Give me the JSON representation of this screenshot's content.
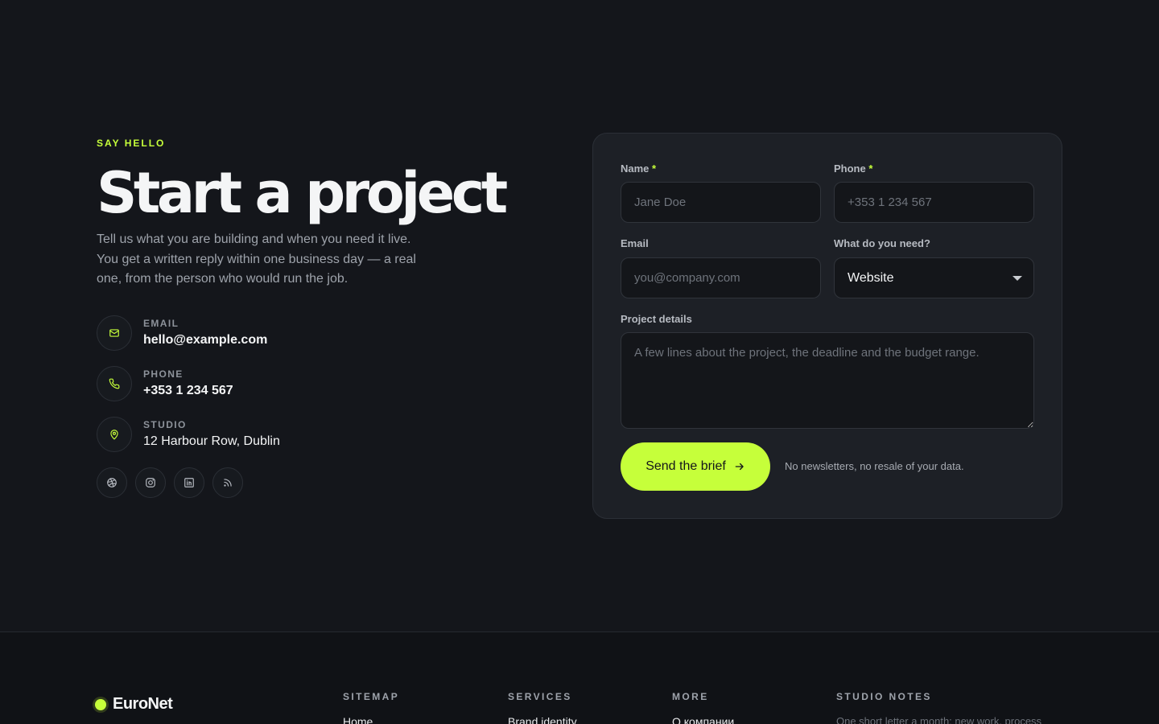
{
  "contact": {
    "eyebrow": "SAY HELLO",
    "title": "Start a project",
    "lede": "Tell us what you are building and when you need it live. You get a written reply within one business day — a real one, from the person who would run the job.",
    "email": {
      "label": "EMAIL",
      "value": "hello@example.com",
      "icon": "mail-icon"
    },
    "phone": {
      "label": "PHONE",
      "value": "+353 1 234 567",
      "icon": "phone-icon"
    },
    "studio": {
      "label": "STUDIO",
      "value": "12 Harbour Row, Dublin",
      "icon": "map-pin-icon"
    },
    "socials": [
      "dribbble-icon",
      "instagram-icon",
      "linkedin-icon",
      "rss-icon"
    ]
  },
  "form": {
    "name": {
      "label": "Name",
      "required_mark": "*",
      "placeholder": "Jane Doe"
    },
    "phone": {
      "label": "Phone",
      "required_mark": "*",
      "placeholder": "+353 1 234 567"
    },
    "email": {
      "label": "Email",
      "placeholder": "you@company.com"
    },
    "need": {
      "label": "What do you need?",
      "selected": "Website"
    },
    "details": {
      "label": "Project details",
      "placeholder": "A few lines about the project, the deadline and the budget range."
    },
    "submit_label": "Send the brief",
    "note": "No newsletters, no resale of your data."
  },
  "footer": {
    "brand": "EuroNet",
    "columns": [
      {
        "heading": "SITEMAP",
        "first_item": "Home"
      },
      {
        "heading": "SERVICES",
        "first_item": "Brand identity"
      },
      {
        "heading": "MORE",
        "first_item": "О компании"
      },
      {
        "heading": "STUDIO NOTES",
        "text": "One short letter a month: new work, process"
      }
    ]
  },
  "colors": {
    "background": "#14161b",
    "card": "#1d2026",
    "accent": "#c6ff3a",
    "muted_text": "#9ea3ab"
  }
}
